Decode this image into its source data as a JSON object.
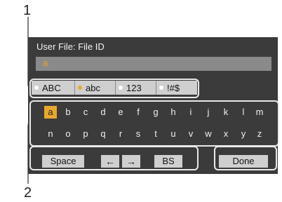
{
  "callouts": {
    "one": "1",
    "two": "2"
  },
  "screen": {
    "title": "User File: File ID",
    "input_value": "a"
  },
  "modes": [
    {
      "label": "ABC",
      "active": false
    },
    {
      "label": "abc",
      "active": true
    },
    {
      "label": "123",
      "active": false
    },
    {
      "label": "!#$",
      "active": false
    }
  ],
  "keyboard": {
    "row1": [
      "a",
      "b",
      "c",
      "d",
      "e",
      "f",
      "g",
      "h",
      "i",
      "j",
      "k",
      "l",
      "m"
    ],
    "row2": [
      "n",
      "o",
      "p",
      "q",
      "r",
      "s",
      "t",
      "u",
      "v",
      "w",
      "x",
      "y",
      "z"
    ],
    "selected_key": "a"
  },
  "buttons": {
    "space": "Space",
    "left": "←",
    "right": "→",
    "bs": "BS",
    "done": "Done"
  },
  "colors": {
    "accent": "#e8a830",
    "panel": "#3b3b3b",
    "button": "#cfcfcf"
  }
}
